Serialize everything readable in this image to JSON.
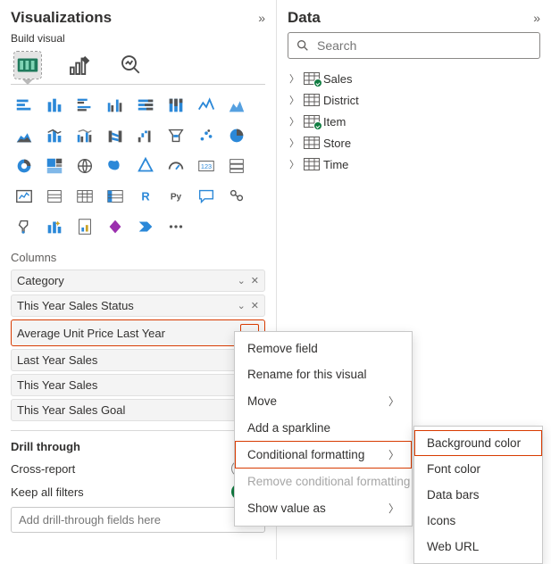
{
  "viz_pane": {
    "title": "Visualizations",
    "subtitle": "Build visual"
  },
  "columns": {
    "label": "Columns",
    "fields": [
      {
        "name": "Category",
        "closeable": true
      },
      {
        "name": "This Year Sales Status",
        "closeable": true
      },
      {
        "name": "Average Unit Price Last Year",
        "closeable": false,
        "highlight": true
      },
      {
        "name": "Last Year Sales",
        "closeable": false
      },
      {
        "name": "This Year Sales",
        "closeable": false
      },
      {
        "name": "This Year Sales Goal",
        "closeable": false
      }
    ]
  },
  "drill": {
    "heading": "Drill through",
    "cross_label": "Cross-report",
    "cross_state": "Off",
    "keep_label": "Keep all filters",
    "keep_state": "On",
    "placeholder": "Add drill-through fields here"
  },
  "data_pane": {
    "title": "Data",
    "search_placeholder": "Search",
    "tables": [
      {
        "name": "Sales",
        "checked": true
      },
      {
        "name": "District",
        "checked": false
      },
      {
        "name": "Item",
        "checked": true
      },
      {
        "name": "Store",
        "checked": false
      },
      {
        "name": "Time",
        "checked": false
      }
    ]
  },
  "ctx_menu": {
    "remove": "Remove field",
    "rename": "Rename for this visual",
    "move": "Move",
    "sparkline": "Add a sparkline",
    "cond_fmt": "Conditional formatting",
    "remove_cond": "Remove conditional formatting",
    "show_as": "Show value as"
  },
  "sub_menu": {
    "bg": "Background color",
    "font": "Font color",
    "bars": "Data bars",
    "icons": "Icons",
    "url": "Web URL"
  }
}
